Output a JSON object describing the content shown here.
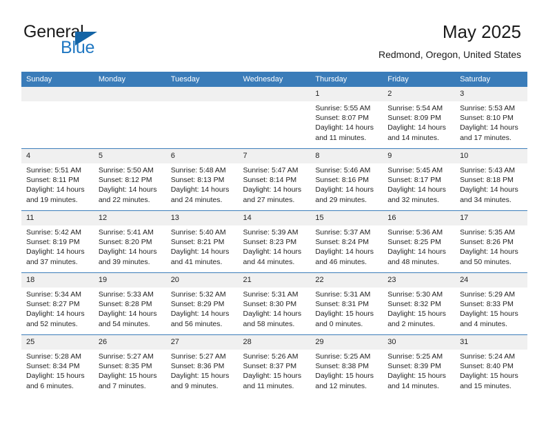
{
  "brand": {
    "name_part1": "General",
    "name_part2": "Blue",
    "triangle_icon": "triangle-icon",
    "accent_color": "#1F77C2",
    "header_color": "#3A7CB9"
  },
  "header": {
    "title": "May 2025",
    "location": "Redmond, Oregon, United States"
  },
  "calendar": {
    "weekdays": [
      "Sunday",
      "Monday",
      "Tuesday",
      "Wednesday",
      "Thursday",
      "Friday",
      "Saturday"
    ],
    "labels": {
      "sunrise": "Sunrise:",
      "sunset": "Sunset:",
      "daylight": "Daylight:"
    },
    "weeks": [
      [
        {
          "day": "",
          "empty": true
        },
        {
          "day": "",
          "empty": true
        },
        {
          "day": "",
          "empty": true
        },
        {
          "day": "",
          "empty": true
        },
        {
          "day": "1",
          "sunrise": "Sunrise: 5:55 AM",
          "sunset": "Sunset: 8:07 PM",
          "daylight": "Daylight: 14 hours and 11 minutes."
        },
        {
          "day": "2",
          "sunrise": "Sunrise: 5:54 AM",
          "sunset": "Sunset: 8:09 PM",
          "daylight": "Daylight: 14 hours and 14 minutes."
        },
        {
          "day": "3",
          "sunrise": "Sunrise: 5:53 AM",
          "sunset": "Sunset: 8:10 PM",
          "daylight": "Daylight: 14 hours and 17 minutes."
        }
      ],
      [
        {
          "day": "4",
          "sunrise": "Sunrise: 5:51 AM",
          "sunset": "Sunset: 8:11 PM",
          "daylight": "Daylight: 14 hours and 19 minutes."
        },
        {
          "day": "5",
          "sunrise": "Sunrise: 5:50 AM",
          "sunset": "Sunset: 8:12 PM",
          "daylight": "Daylight: 14 hours and 22 minutes."
        },
        {
          "day": "6",
          "sunrise": "Sunrise: 5:48 AM",
          "sunset": "Sunset: 8:13 PM",
          "daylight": "Daylight: 14 hours and 24 minutes."
        },
        {
          "day": "7",
          "sunrise": "Sunrise: 5:47 AM",
          "sunset": "Sunset: 8:14 PM",
          "daylight": "Daylight: 14 hours and 27 minutes."
        },
        {
          "day": "8",
          "sunrise": "Sunrise: 5:46 AM",
          "sunset": "Sunset: 8:16 PM",
          "daylight": "Daylight: 14 hours and 29 minutes."
        },
        {
          "day": "9",
          "sunrise": "Sunrise: 5:45 AM",
          "sunset": "Sunset: 8:17 PM",
          "daylight": "Daylight: 14 hours and 32 minutes."
        },
        {
          "day": "10",
          "sunrise": "Sunrise: 5:43 AM",
          "sunset": "Sunset: 8:18 PM",
          "daylight": "Daylight: 14 hours and 34 minutes."
        }
      ],
      [
        {
          "day": "11",
          "sunrise": "Sunrise: 5:42 AM",
          "sunset": "Sunset: 8:19 PM",
          "daylight": "Daylight: 14 hours and 37 minutes."
        },
        {
          "day": "12",
          "sunrise": "Sunrise: 5:41 AM",
          "sunset": "Sunset: 8:20 PM",
          "daylight": "Daylight: 14 hours and 39 minutes."
        },
        {
          "day": "13",
          "sunrise": "Sunrise: 5:40 AM",
          "sunset": "Sunset: 8:21 PM",
          "daylight": "Daylight: 14 hours and 41 minutes."
        },
        {
          "day": "14",
          "sunrise": "Sunrise: 5:39 AM",
          "sunset": "Sunset: 8:23 PM",
          "daylight": "Daylight: 14 hours and 44 minutes."
        },
        {
          "day": "15",
          "sunrise": "Sunrise: 5:37 AM",
          "sunset": "Sunset: 8:24 PM",
          "daylight": "Daylight: 14 hours and 46 minutes."
        },
        {
          "day": "16",
          "sunrise": "Sunrise: 5:36 AM",
          "sunset": "Sunset: 8:25 PM",
          "daylight": "Daylight: 14 hours and 48 minutes."
        },
        {
          "day": "17",
          "sunrise": "Sunrise: 5:35 AM",
          "sunset": "Sunset: 8:26 PM",
          "daylight": "Daylight: 14 hours and 50 minutes."
        }
      ],
      [
        {
          "day": "18",
          "sunrise": "Sunrise: 5:34 AM",
          "sunset": "Sunset: 8:27 PM",
          "daylight": "Daylight: 14 hours and 52 minutes."
        },
        {
          "day": "19",
          "sunrise": "Sunrise: 5:33 AM",
          "sunset": "Sunset: 8:28 PM",
          "daylight": "Daylight: 14 hours and 54 minutes."
        },
        {
          "day": "20",
          "sunrise": "Sunrise: 5:32 AM",
          "sunset": "Sunset: 8:29 PM",
          "daylight": "Daylight: 14 hours and 56 minutes."
        },
        {
          "day": "21",
          "sunrise": "Sunrise: 5:31 AM",
          "sunset": "Sunset: 8:30 PM",
          "daylight": "Daylight: 14 hours and 58 minutes."
        },
        {
          "day": "22",
          "sunrise": "Sunrise: 5:31 AM",
          "sunset": "Sunset: 8:31 PM",
          "daylight": "Daylight: 15 hours and 0 minutes."
        },
        {
          "day": "23",
          "sunrise": "Sunrise: 5:30 AM",
          "sunset": "Sunset: 8:32 PM",
          "daylight": "Daylight: 15 hours and 2 minutes."
        },
        {
          "day": "24",
          "sunrise": "Sunrise: 5:29 AM",
          "sunset": "Sunset: 8:33 PM",
          "daylight": "Daylight: 15 hours and 4 minutes."
        }
      ],
      [
        {
          "day": "25",
          "sunrise": "Sunrise: 5:28 AM",
          "sunset": "Sunset: 8:34 PM",
          "daylight": "Daylight: 15 hours and 6 minutes."
        },
        {
          "day": "26",
          "sunrise": "Sunrise: 5:27 AM",
          "sunset": "Sunset: 8:35 PM",
          "daylight": "Daylight: 15 hours and 7 minutes."
        },
        {
          "day": "27",
          "sunrise": "Sunrise: 5:27 AM",
          "sunset": "Sunset: 8:36 PM",
          "daylight": "Daylight: 15 hours and 9 minutes."
        },
        {
          "day": "28",
          "sunrise": "Sunrise: 5:26 AM",
          "sunset": "Sunset: 8:37 PM",
          "daylight": "Daylight: 15 hours and 11 minutes."
        },
        {
          "day": "29",
          "sunrise": "Sunrise: 5:25 AM",
          "sunset": "Sunset: 8:38 PM",
          "daylight": "Daylight: 15 hours and 12 minutes."
        },
        {
          "day": "30",
          "sunrise": "Sunrise: 5:25 AM",
          "sunset": "Sunset: 8:39 PM",
          "daylight": "Daylight: 15 hours and 14 minutes."
        },
        {
          "day": "31",
          "sunrise": "Sunrise: 5:24 AM",
          "sunset": "Sunset: 8:40 PM",
          "daylight": "Daylight: 15 hours and 15 minutes."
        }
      ]
    ]
  }
}
